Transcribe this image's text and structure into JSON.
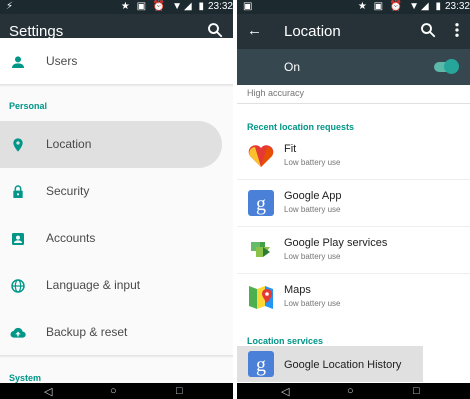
{
  "status": {
    "time": "23:32"
  },
  "settings": {
    "title": "Settings",
    "sections": {
      "personal": "Personal",
      "system": "System"
    },
    "items": [
      {
        "label": "Users",
        "icon": "person-icon"
      },
      {
        "label": "Location",
        "icon": "location-pin-icon",
        "selected": true
      },
      {
        "label": "Security",
        "icon": "lock-icon"
      },
      {
        "label": "Accounts",
        "icon": "account-box-icon"
      },
      {
        "label": "Language & input",
        "icon": "globe-icon"
      },
      {
        "label": "Backup & reset",
        "icon": "cloud-upload-icon"
      }
    ]
  },
  "location": {
    "title": "Location",
    "toggle_label": "On",
    "toggle_on": true,
    "mode": "High accuracy",
    "recent_header": "Recent location requests",
    "requests": [
      {
        "name": "Fit",
        "sub": "Low battery use",
        "icon": "fit-heart-icon"
      },
      {
        "name": "Google App",
        "sub": "Low battery use",
        "icon": "google-g-icon"
      },
      {
        "name": "Google Play services",
        "sub": "Low battery use",
        "icon": "play-services-icon"
      },
      {
        "name": "Maps",
        "sub": "Low battery use",
        "icon": "maps-icon"
      }
    ],
    "services_header": "Location services",
    "services": [
      {
        "name": "Google Location History",
        "icon": "google-g-icon"
      }
    ]
  },
  "colors": {
    "appbar": "#263238",
    "accent": "#009688",
    "toggle": "#26a69a"
  }
}
